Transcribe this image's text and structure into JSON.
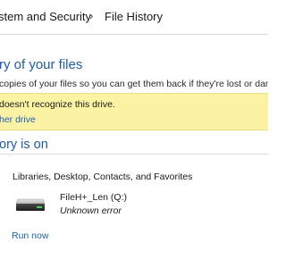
{
  "breadcrumb": {
    "items": [
      "stem and Security",
      "File History"
    ],
    "separator": "›"
  },
  "main": {
    "heading": "ry of your files",
    "description": "copies of your files so you can get them back if they're lost or dama",
    "warning": {
      "message": "doesn't recognize this drive.",
      "link": "her drive",
      "background": "#fbf3a3"
    },
    "status_heading": "ory is on",
    "libraries": "Libraries, Desktop, Contacts, and Favorites",
    "drive": {
      "name": "FileH+_Len (Q:)",
      "status": "Unknown error",
      "icon": "drive-icon"
    },
    "run_now": "Run now"
  },
  "colors": {
    "heading": "#1f5ba8",
    "link": "#1c5fb4"
  }
}
